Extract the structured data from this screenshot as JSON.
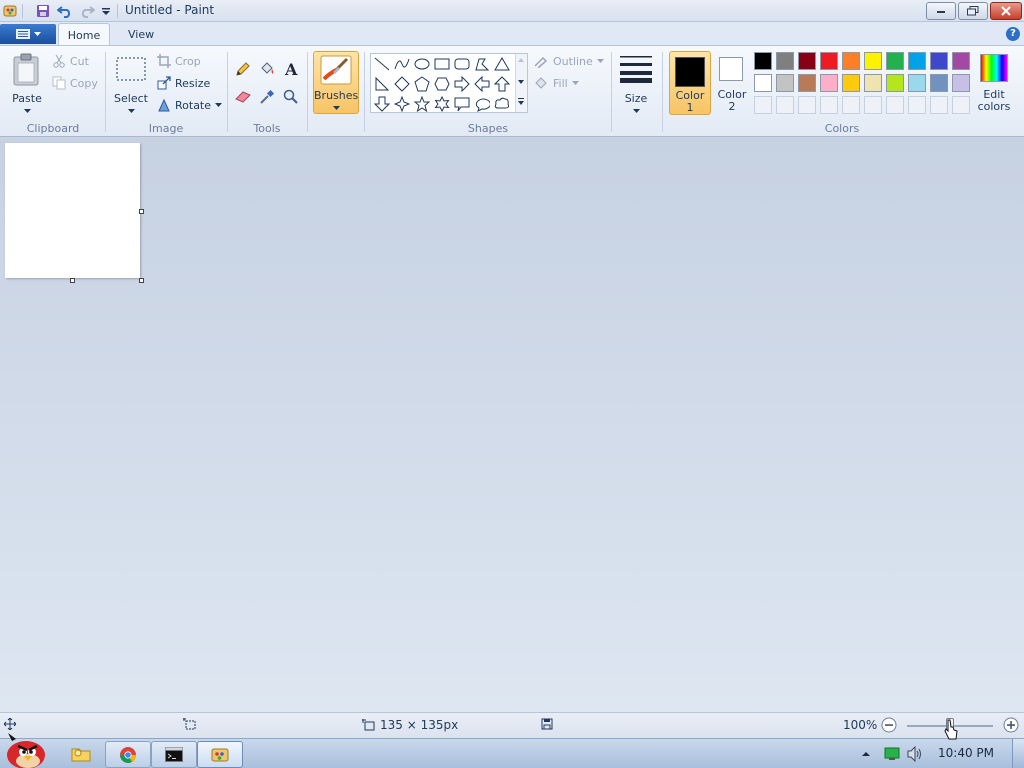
{
  "window": {
    "title": "Untitled - Paint"
  },
  "tabs": {
    "home": "Home",
    "view": "View"
  },
  "clipboard": {
    "paste": "Paste",
    "cut": "Cut",
    "copy": "Copy",
    "group": "Clipboard"
  },
  "image": {
    "select": "Select",
    "crop": "Crop",
    "resize": "Resize",
    "rotate": "Rotate",
    "group": "Image"
  },
  "tools": {
    "group": "Tools",
    "items": [
      "pencil-icon",
      "fill-bucket-icon",
      "text-icon",
      "eraser-icon",
      "color-picker-icon",
      "magnifier-icon"
    ]
  },
  "brushes": {
    "label": "Brushes"
  },
  "shapes": {
    "group": "Shapes",
    "outline": "Outline",
    "fill": "Fill"
  },
  "size": {
    "label": "Size"
  },
  "colors": {
    "group": "Colors",
    "color1_line1": "Color",
    "color1_line2": "1",
    "color2_line1": "Color",
    "color2_line2": "2",
    "edit_line1": "Edit",
    "edit_line2": "colors",
    "color1_value": "#000000",
    "color2_value": "#ffffff",
    "palette_row1": [
      "#000000",
      "#7f7f7f",
      "#880015",
      "#ed1c24",
      "#ff7f27",
      "#fff200",
      "#22b14c",
      "#00a2e8",
      "#3f48cc",
      "#a349a4"
    ],
    "palette_row2": [
      "#ffffff",
      "#c3c3c3",
      "#b97a57",
      "#ffaec9",
      "#ffc90e",
      "#efe4b0",
      "#b5e61d",
      "#99d9ea",
      "#7092be",
      "#c8bfe7"
    ]
  },
  "status": {
    "canvas_size": "135 × 135px",
    "zoom": "100%",
    "zoom_fraction": 0.5
  },
  "taskbar": {
    "clock": "10:40 PM"
  }
}
